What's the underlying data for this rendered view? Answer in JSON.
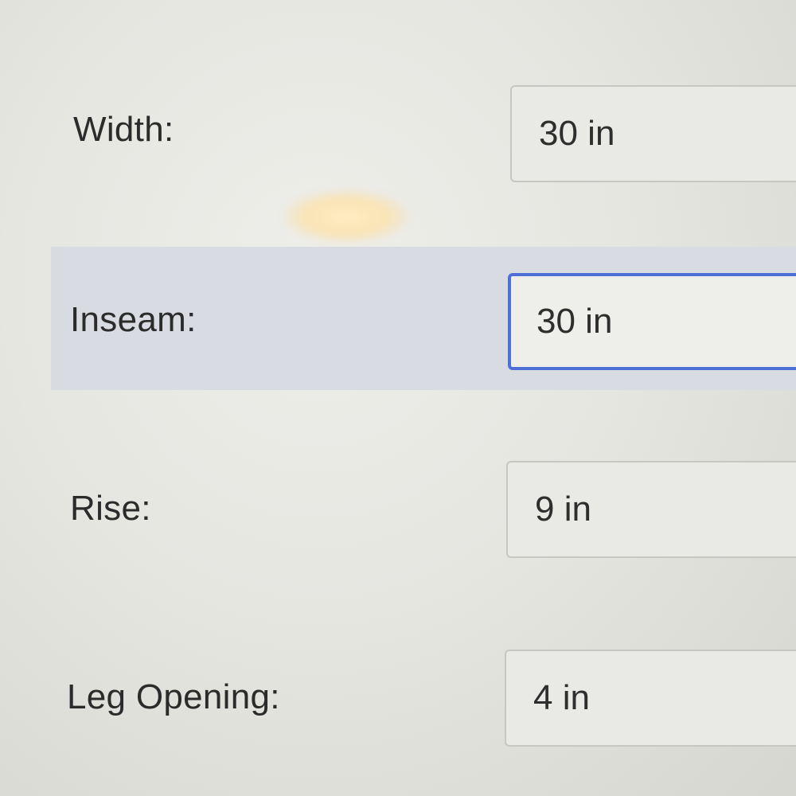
{
  "measurements": [
    {
      "label": "Width:",
      "value": "30 in",
      "focused": false
    },
    {
      "label": "Inseam:",
      "value": "30 in",
      "focused": true
    },
    {
      "label": "Rise:",
      "value": "9 in",
      "focused": false
    },
    {
      "label": "Leg Opening:",
      "value": "4 in",
      "focused": false
    }
  ],
  "colors": {
    "focus_border": "#4d6fd6",
    "row_highlight": "#d9dbe2",
    "field_border": "#c6c6c2"
  }
}
